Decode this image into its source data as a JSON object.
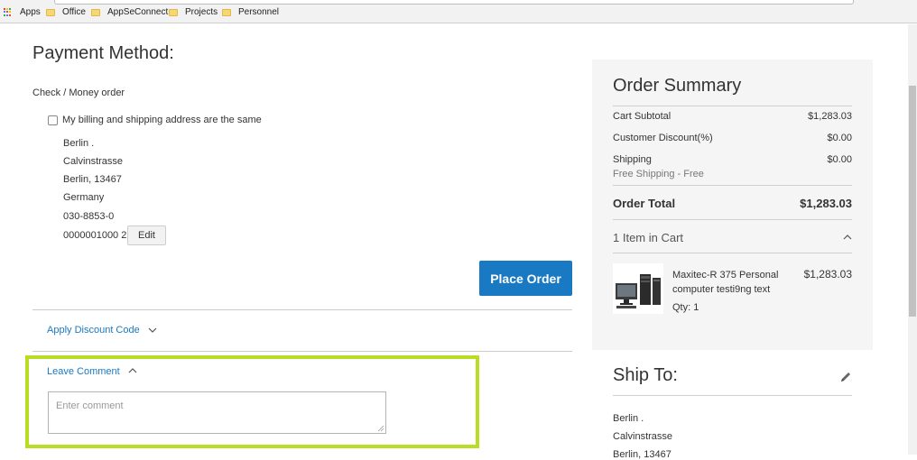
{
  "bookmarks": {
    "items": [
      "Apps",
      "Office",
      "AppSeConnect",
      "Projects",
      "Personnel"
    ]
  },
  "payment": {
    "title": "Payment Method:",
    "method": "Check / Money order",
    "same_address_label": "My billing and shipping address are the same",
    "address_lines": [
      "Berlin .",
      "Calvinstrasse",
      "Berlin, 13467",
      "Germany",
      "030-8853-0",
      "0000001000 2"
    ],
    "edit_label": "Edit",
    "place_order_label": "Place Order"
  },
  "discount": {
    "label": "Apply Discount Code"
  },
  "comment": {
    "label": "Leave Comment",
    "placeholder": "Enter comment",
    "highlight_color": "#b9dd24"
  },
  "summary": {
    "title": "Order Summary",
    "rows": [
      {
        "label": "Cart Subtotal",
        "value": "$1,283.03"
      },
      {
        "label": "Customer Discount(%)",
        "value": "$0.00"
      },
      {
        "label": "Shipping",
        "value": "$0.00"
      }
    ],
    "shipping_note": "Free Shipping - Free",
    "total_label": "Order Total",
    "total_value": "$1,283.03",
    "items_in_cart": "1 Item in Cart",
    "product": {
      "name": "Maxitec-R 375 Personal computer testi9ng text",
      "price": "$1,283.03",
      "qty": "Qty: 1"
    }
  },
  "ship_to": {
    "title": "Ship To:",
    "lines": [
      "Berlin .",
      "Calvinstrasse",
      "Berlin, 13467"
    ]
  },
  "colors": {
    "accent": "#1979c3",
    "summary_bg": "#f5f5f5"
  }
}
